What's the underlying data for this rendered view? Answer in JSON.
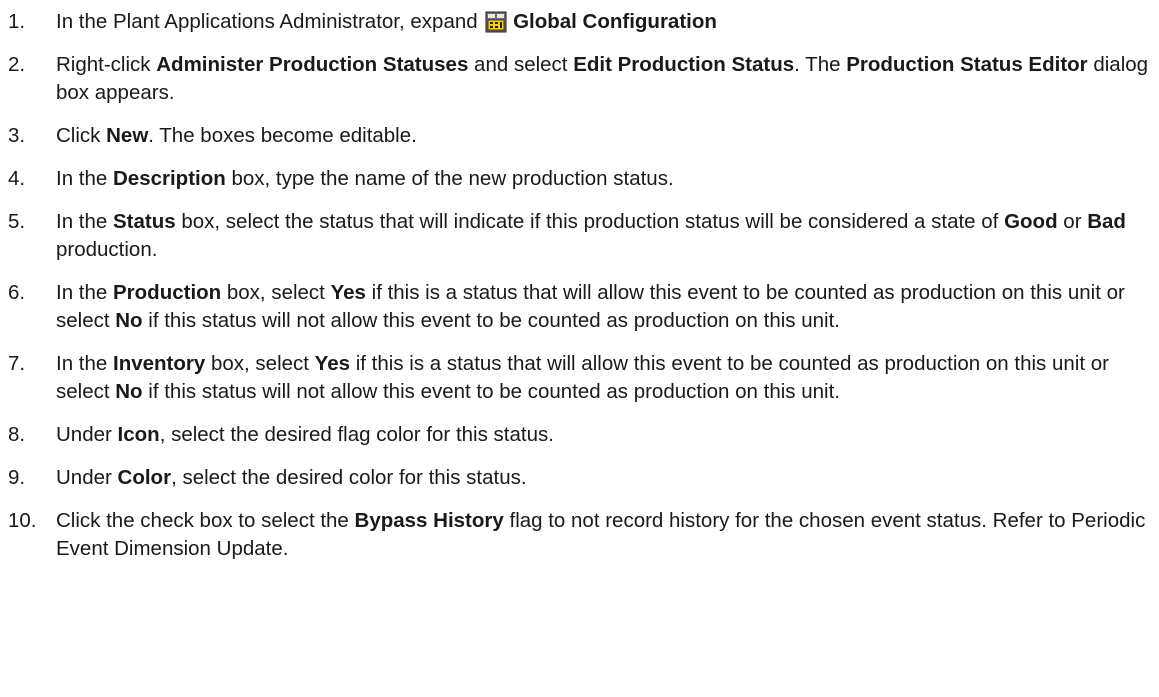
{
  "steps": [
    {
      "num": "1.",
      "parts": [
        {
          "t": "In the Plant Applications Administrator, expand "
        },
        {
          "icon": "global-configuration-icon"
        },
        {
          "t": "Global Configuration",
          "b": true
        }
      ]
    },
    {
      "num": "2.",
      "parts": [
        {
          "t": "Right-click "
        },
        {
          "t": "Administer Production Statuses",
          "b": true
        },
        {
          "t": " and select "
        },
        {
          "t": "Edit Production Status",
          "b": true
        },
        {
          "t": ". The "
        },
        {
          "t": "Production Status Editor",
          "b": true
        },
        {
          "t": " dialog box appears."
        }
      ]
    },
    {
      "num": "3.",
      "parts": [
        {
          "t": "Click "
        },
        {
          "t": "New",
          "b": true
        },
        {
          "t": ". The boxes become editable."
        }
      ]
    },
    {
      "num": "4.",
      "parts": [
        {
          "t": "In the "
        },
        {
          "t": "Description",
          "b": true
        },
        {
          "t": " box, type the name of the new production status."
        }
      ]
    },
    {
      "num": "5.",
      "parts": [
        {
          "t": "In the "
        },
        {
          "t": "Status",
          "b": true
        },
        {
          "t": " box, select the status that will indicate if this production status will be considered a state of "
        },
        {
          "t": "Good",
          "b": true
        },
        {
          "t": " or "
        },
        {
          "t": "Bad",
          "b": true
        },
        {
          "t": " production."
        }
      ]
    },
    {
      "num": "6.",
      "parts": [
        {
          "t": "In the "
        },
        {
          "t": "Production",
          "b": true
        },
        {
          "t": " box, select "
        },
        {
          "t": "Yes",
          "b": true
        },
        {
          "t": " if this is a status that will allow this event to be counted as production on this unit or select "
        },
        {
          "t": "No",
          "b": true
        },
        {
          "t": " if this status will not allow this event to be counted as production on this unit."
        }
      ]
    },
    {
      "num": "7.",
      "parts": [
        {
          "t": "In the "
        },
        {
          "t": "Inventory",
          "b": true
        },
        {
          "t": " box, select "
        },
        {
          "t": "Yes",
          "b": true
        },
        {
          "t": " if this is a status that will allow this event to be counted as production on this unit or select "
        },
        {
          "t": "No",
          "b": true
        },
        {
          "t": " if this status will not allow this event to be counted as production on this unit."
        }
      ]
    },
    {
      "num": "8.",
      "parts": [
        {
          "t": "Under "
        },
        {
          "t": "Icon",
          "b": true
        },
        {
          "t": ", select the desired flag color for this status."
        }
      ]
    },
    {
      "num": "9.",
      "parts": [
        {
          "t": "Under "
        },
        {
          "t": "Color",
          "b": true
        },
        {
          "t": ", select the desired color for this status."
        }
      ]
    },
    {
      "num": "10.",
      "parts": [
        {
          "t": "Click the check box to select the "
        },
        {
          "t": "Bypass History",
          "b": true
        },
        {
          "t": " flag to not record history for the chosen event status. Refer to Periodic Event Dimension Update."
        }
      ]
    }
  ]
}
